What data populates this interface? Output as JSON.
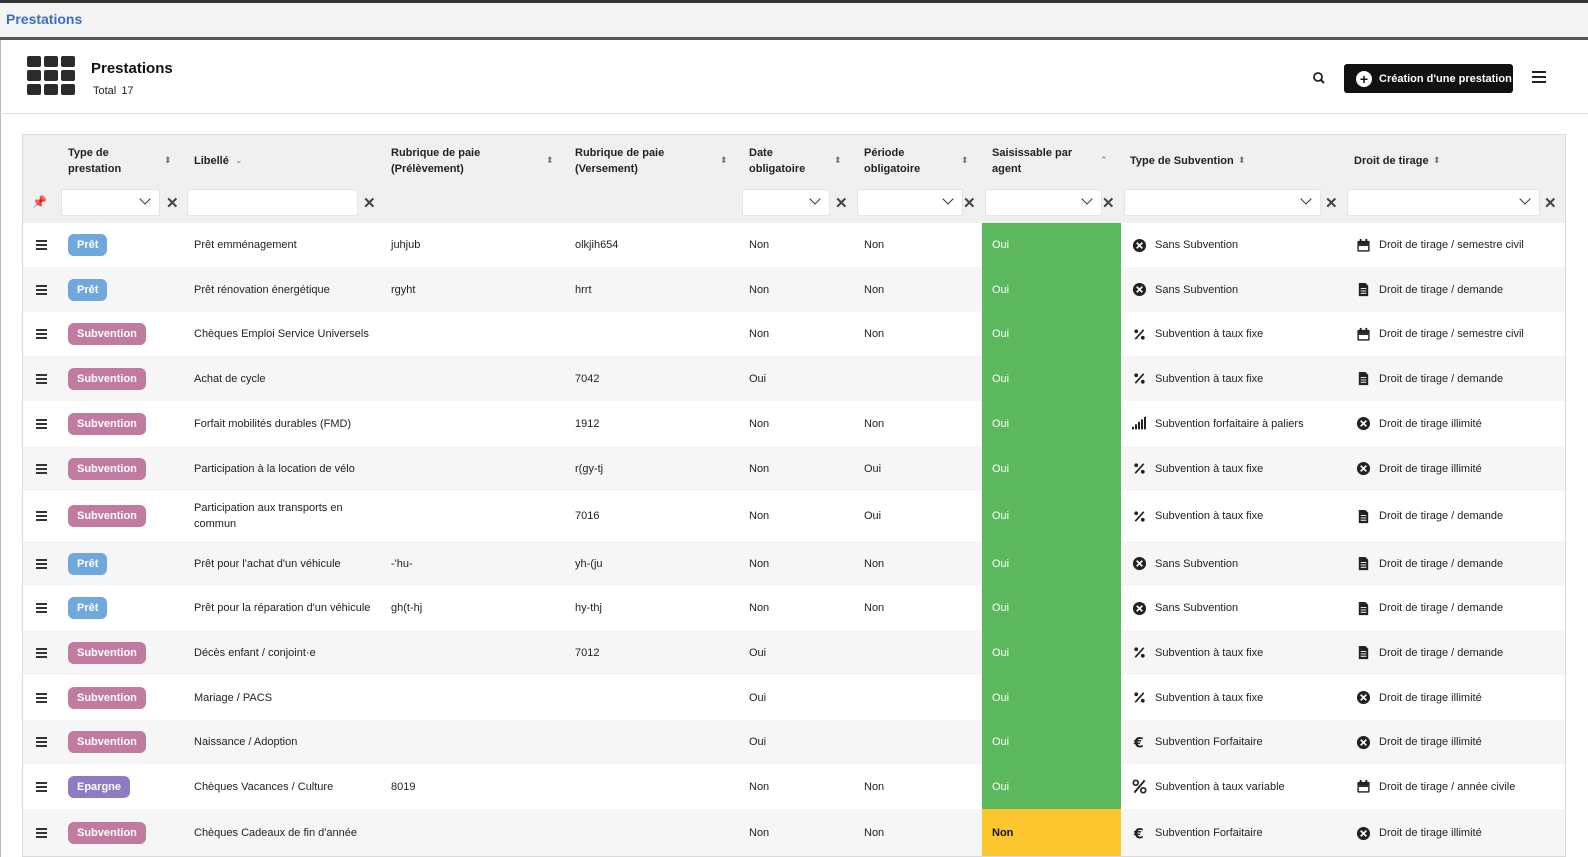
{
  "window": {
    "title": "Prestations"
  },
  "header": {
    "title": "Prestations",
    "total_label": "Total",
    "total_value": "17",
    "create_label": "Création d'une prestation"
  },
  "columns": [
    "Type de prestation",
    "Libellé",
    "Rubrique de paie (Prélèvement)",
    "Rubrique de paie (Versement)",
    "Date obligatoire",
    "Période obligatoire",
    "Saisissable par agent",
    "Type de Subvention",
    "Droit de tirage"
  ],
  "colors": {
    "pret": "#6fa8dc",
    "subvention": "#c27ba0",
    "epargne": "#8e7cc3",
    "oui": "#5cb85c",
    "non": "#fcc72e"
  },
  "rows": [
    {
      "type": "Prêt",
      "libelle": "Prêt emménagement",
      "prelev": "juhjub",
      "vers": "olkjih654",
      "date": "Non",
      "periode": "Non",
      "saisi": "Oui",
      "sub_icon": "times-circle-icon",
      "sub": "Sans Subvention",
      "droit_icon": "calendar-icon",
      "droit": "Droit de tirage / semestre civil"
    },
    {
      "type": "Prêt",
      "libelle": "Prêt rénovation énergétique",
      "prelev": "rgyht",
      "vers": "hrrt",
      "date": "Non",
      "periode": "Non",
      "saisi": "Oui",
      "sub_icon": "times-circle-icon",
      "sub": "Sans Subvention",
      "droit_icon": "file-icon",
      "droit": "Droit de tirage / demande"
    },
    {
      "type": "Subvention",
      "libelle": "Chèques Emploi Service Universels",
      "prelev": "",
      "vers": "",
      "date": "Non",
      "periode": "Non",
      "saisi": "Oui",
      "sub_icon": "percent-small-icon",
      "sub": "Subvention à taux fixe",
      "droit_icon": "calendar-icon",
      "droit": "Droit de tirage / semestre civil"
    },
    {
      "type": "Subvention",
      "libelle": "Achat de cycle",
      "prelev": "",
      "vers": "7042",
      "date": "Oui",
      "periode": "",
      "saisi": "Oui",
      "sub_icon": "percent-small-icon",
      "sub": "Subvention à taux fixe",
      "droit_icon": "file-icon",
      "droit": "Droit de tirage / demande"
    },
    {
      "type": "Subvention",
      "libelle": "Forfait mobilités durables (FMD)",
      "prelev": "",
      "vers": "1912",
      "date": "Non",
      "periode": "Non",
      "saisi": "Oui",
      "sub_icon": "signal-bars-icon",
      "sub": "Subvention forfaitaire à paliers",
      "droit_icon": "times-circle-icon",
      "droit": "Droit de tirage illimité"
    },
    {
      "type": "Subvention",
      "libelle": "Participation à la location de vélo",
      "prelev": "",
      "vers": "r(gy-tj",
      "date": "Non",
      "periode": "Oui",
      "saisi": "Oui",
      "sub_icon": "percent-small-icon",
      "sub": "Subvention à taux fixe",
      "droit_icon": "times-circle-icon",
      "droit": "Droit de tirage illimité"
    },
    {
      "type": "Subvention",
      "libelle": "Participation aux transports en commun",
      "prelev": "",
      "vers": "7016",
      "date": "Non",
      "periode": "Oui",
      "saisi": "Oui",
      "sub_icon": "percent-small-icon",
      "sub": "Subvention à taux fixe",
      "droit_icon": "file-icon",
      "droit": "Droit de tirage / demande"
    },
    {
      "type": "Prêt",
      "libelle": "Prêt pour l'achat d'un véhicule",
      "prelev": "-'hu-",
      "vers": "yh-(ju",
      "date": "Non",
      "periode": "Non",
      "saisi": "Oui",
      "sub_icon": "times-circle-icon",
      "sub": "Sans Subvention",
      "droit_icon": "file-icon",
      "droit": "Droit de tirage / demande"
    },
    {
      "type": "Prêt",
      "libelle": "Prêt pour la réparation d'un véhicule",
      "prelev": "gh(t-hj",
      "vers": "hy-thj",
      "date": "Non",
      "periode": "Non",
      "saisi": "Oui",
      "sub_icon": "times-circle-icon",
      "sub": "Sans Subvention",
      "droit_icon": "file-icon",
      "droit": "Droit de tirage / demande"
    },
    {
      "type": "Subvention",
      "libelle": "Décès enfant / conjoint·e",
      "prelev": "",
      "vers": "7012",
      "date": "Oui",
      "periode": "",
      "saisi": "Oui",
      "sub_icon": "percent-small-icon",
      "sub": "Subvention à taux fixe",
      "droit_icon": "file-icon",
      "droit": "Droit de tirage / demande"
    },
    {
      "type": "Subvention",
      "libelle": "Mariage / PACS",
      "prelev": "",
      "vers": "",
      "date": "Oui",
      "periode": "",
      "saisi": "Oui",
      "sub_icon": "percent-small-icon",
      "sub": "Subvention à taux fixe",
      "droit_icon": "times-circle-icon",
      "droit": "Droit de tirage illimité"
    },
    {
      "type": "Subvention",
      "libelle": "Naissance / Adoption",
      "prelev": "",
      "vers": "",
      "date": "Oui",
      "periode": "",
      "saisi": "Oui",
      "sub_icon": "euro-icon",
      "sub": "Subvention Forfaitaire",
      "droit_icon": "times-circle-icon",
      "droit": "Droit de tirage illimité"
    },
    {
      "type": "Epargne",
      "libelle": "Chèques Vacances / Culture",
      "prelev": "8019",
      "vers": "",
      "date": "Non",
      "periode": "Non",
      "saisi": "Oui",
      "sub_icon": "percent-icon",
      "sub": "Subvention à taux variable",
      "droit_icon": "calendar-icon",
      "droit": "Droit de tirage / année civile"
    },
    {
      "type": "Subvention",
      "libelle": "Chèques Cadeaux de fin d'année",
      "prelev": "",
      "vers": "",
      "date": "Non",
      "periode": "Non",
      "saisi": "Non",
      "sub_icon": "euro-icon",
      "sub": "Subvention Forfaitaire",
      "droit_icon": "times-circle-icon",
      "droit": "Droit de tirage illimité"
    }
  ]
}
